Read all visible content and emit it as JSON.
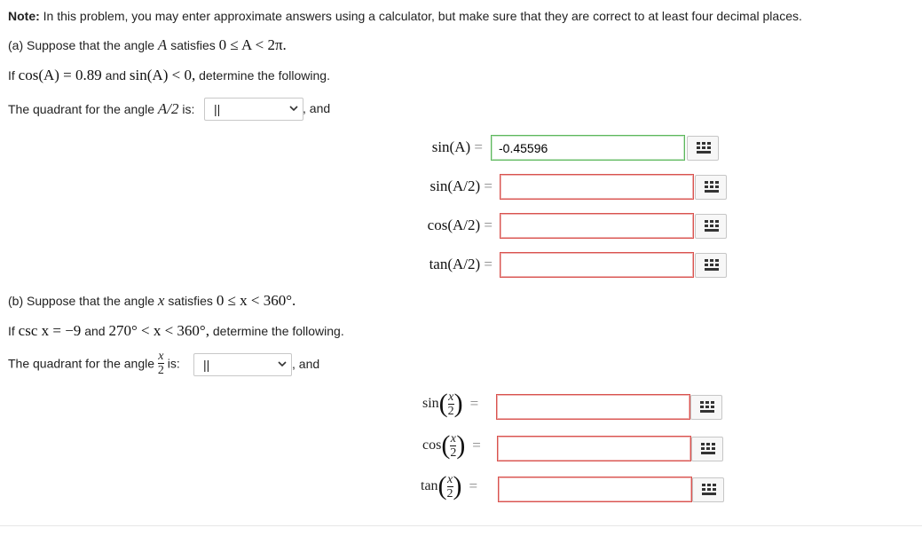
{
  "note": {
    "label": "Note:",
    "text": "In this problem, you may enter approximate answers using a calculator, but make sure that they are correct to at least four decimal places."
  },
  "part_a": {
    "intro": "(a) Suppose that the angle",
    "intro_var": "A",
    "intro_text": "satisfies",
    "intro_condition": "0 ≤ A < 2π.",
    "given_prefix": "If",
    "given_cos": "cos(A) = 0.89",
    "given_and": "and",
    "given_sin": "sin(A) < 0,",
    "given_suffix": "determine the following.",
    "quadrant_text": "The quadrant for the angle",
    "quadrant_angle": "A/2",
    "quadrant_is": "is:",
    "quadrant_value": "||",
    "quadrant_and": ", and",
    "rows": [
      {
        "label": "sin(A)",
        "eq": "=",
        "value": "-0.45596"
      },
      {
        "label": "sin(A/2)",
        "eq": "=",
        "value": ""
      },
      {
        "label": "cos(A/2)",
        "eq": "=",
        "value": ""
      },
      {
        "label": "tan(A/2)",
        "eq": "=",
        "value": ""
      }
    ]
  },
  "part_b": {
    "intro": "(b) Suppose that the angle",
    "intro_var": "x",
    "intro_text": "satisfies",
    "intro_condition": "0 ≤ x < 360°.",
    "given_prefix": "If",
    "given_csc": "csc x = −9",
    "given_and": "and",
    "given_range": "270° < x < 360°,",
    "given_suffix": "determine the following.",
    "quadrant_text": "The quadrant for the angle",
    "frac_num": "x",
    "frac_den": "2",
    "quadrant_is": "is:",
    "quadrant_value": "||",
    "quadrant_and": ", and",
    "rows": [
      {
        "fn": "sin",
        "eq": "=",
        "value": ""
      },
      {
        "fn": "cos",
        "eq": "=",
        "value": ""
      },
      {
        "fn": "tan",
        "eq": "=",
        "value": ""
      }
    ]
  }
}
